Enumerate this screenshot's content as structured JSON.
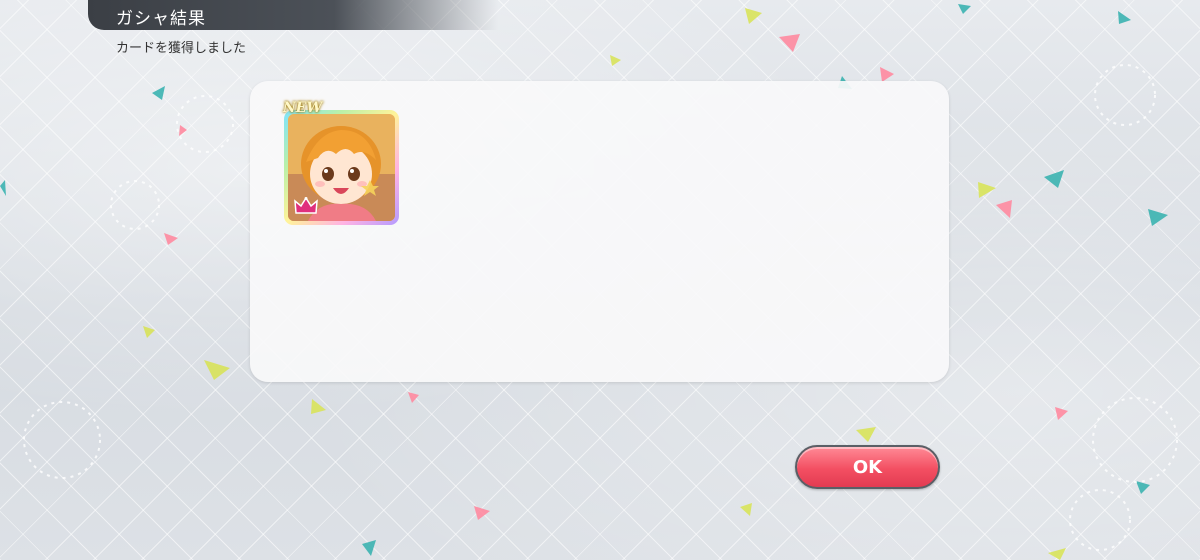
{
  "header": {
    "title": "ガシャ結果",
    "subtitle": "カードを獲得しました"
  },
  "result_panel": {
    "cards": [
      {
        "badge": "NEW",
        "icon": "idol-portrait-icon",
        "frame": "rainbow",
        "rank_icon": "crown-icon"
      }
    ]
  },
  "actions": {
    "ok_label": "OK"
  },
  "colors": {
    "header_bg": "#3b3f45",
    "ok_button": "#f34f62",
    "crown": "#e0307d",
    "panel_bg": "#f8f9fa"
  }
}
